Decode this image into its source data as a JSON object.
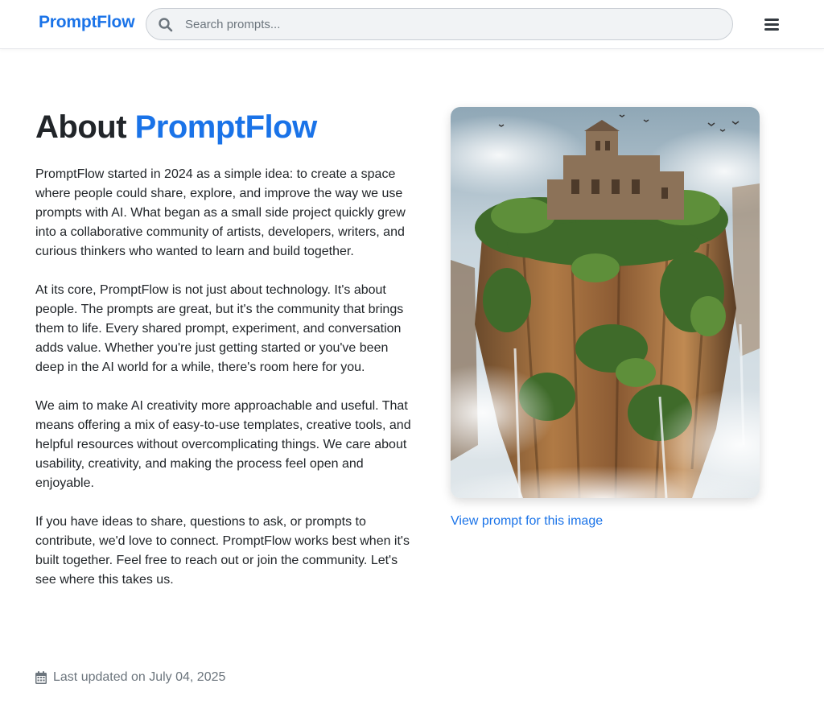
{
  "navbar": {
    "brand": "PromptFlow",
    "search": {
      "placeholder": "Search prompts..."
    },
    "menu_icon": "hamburger-menu-icon",
    "search_icon": "search-icon"
  },
  "page": {
    "title_prefix": "About ",
    "title_accent": "PromptFlow",
    "paragraphs": [
      "PromptFlow started in 2024 as a simple idea: to create a space where people could share, explore, and improve the way we use prompts with AI. What began as a small side project quickly grew into a collaborative community of artists, developers, writers, and curious thinkers who wanted to learn and build together.",
      "At its core, PromptFlow is not just about technology. It's about people. The prompts are great, but it's the community that brings them to life. Every shared prompt, experiment, and conversation adds value. Whether you're just getting started or you've been deep in the AI world for a while, there's room here for you.",
      "We aim to make AI creativity more approachable and useful. That means offering a mix of easy-to-use templates, creative tools, and helpful resources without overcomplicating things. We care about usability, creativity, and making the process feel open and enjoyable.",
      "If you have ideas to share, questions to ask, or prompts to contribute, we'd love to connect. PromptFlow works best when it's built together. Feel free to reach out or join the community. Let's see where this takes us."
    ],
    "last_updated": "Last updated on July 04, 2025",
    "calendar_icon": "calendar-icon"
  },
  "featured_image": {
    "link_text": "View prompt for this image"
  },
  "colors": {
    "accent": "#1a73e8",
    "text": "#212529",
    "muted": "#6c757d",
    "search_bg": "#f1f3f5"
  }
}
